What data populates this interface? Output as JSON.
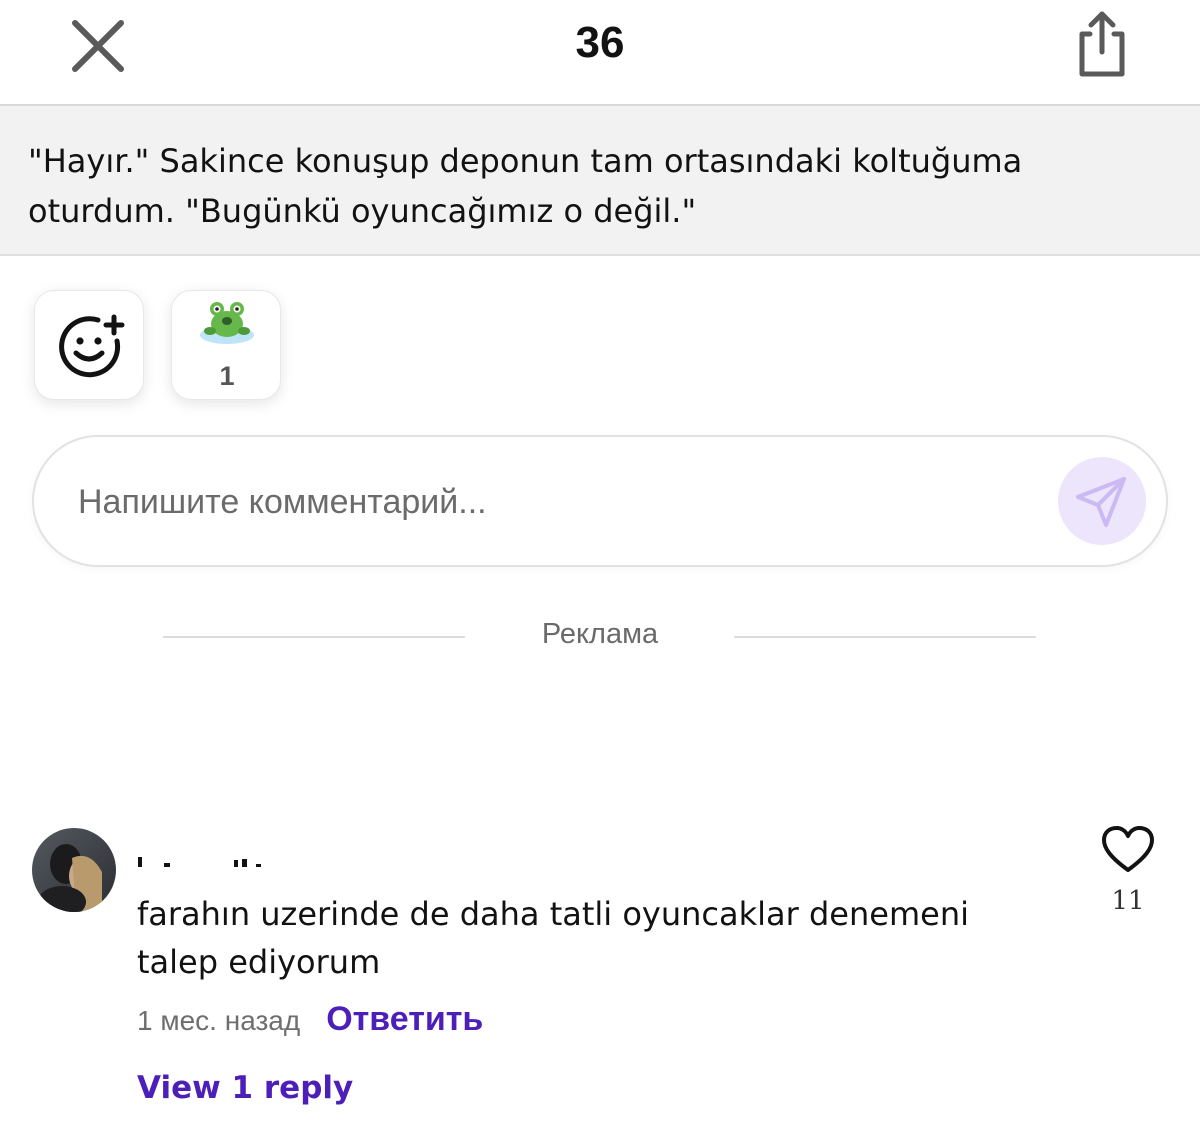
{
  "header": {
    "title": "36",
    "close_icon": "close-icon",
    "share_icon": "share-icon"
  },
  "paragraph": {
    "text": "\"Hayır.\" Sakince konuşup deponun tam ortasındaki koltuğuma oturdum. \"Bugünkü oyuncağımız o değil.\""
  },
  "reactions": {
    "add_icon": "add-emoji-icon",
    "items": [
      {
        "icon": "frog-sticker",
        "count": "1"
      }
    ]
  },
  "comment_input": {
    "placeholder": "Напишите комментарий...",
    "value": "",
    "send_icon": "send-icon",
    "send_color": "#ece5fb"
  },
  "ad": {
    "label": "Реклама"
  },
  "comments": [
    {
      "text": "farahın uzerinde de daha tatli oyuncaklar denemeni talep ediyorum",
      "time": "1 мес. назад",
      "reply_label": "Ответить",
      "view_replies_label": "View 1 reply",
      "likes": "11"
    }
  ],
  "colors": {
    "accent": "#4c1fb8",
    "quote_bg": "#f2f2f2"
  }
}
